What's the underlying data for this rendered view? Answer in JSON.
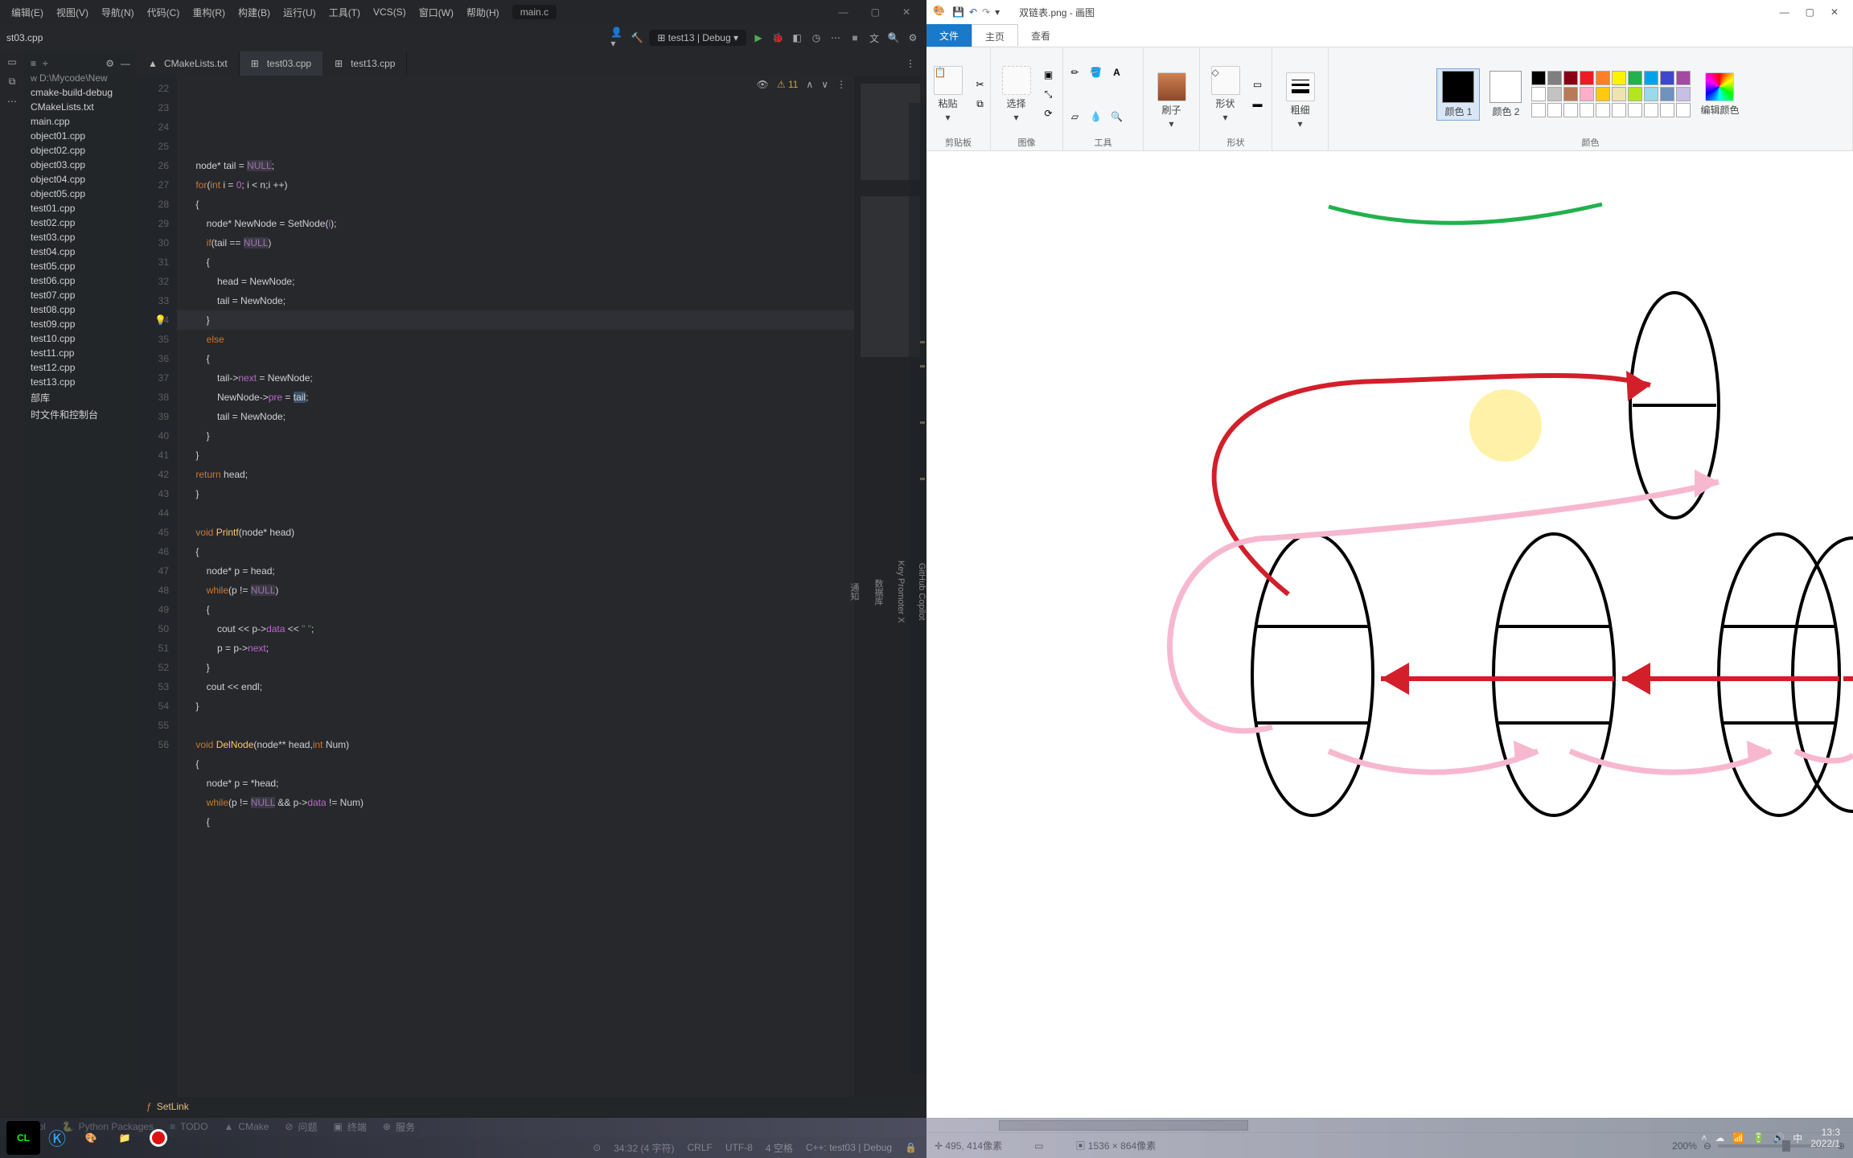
{
  "clion": {
    "title_combo": "main.c",
    "menu": [
      "编辑(E)",
      "视图(V)",
      "导航(N)",
      "代码(C)",
      "重构(R)",
      "构建(B)",
      "运行(U)",
      "工具(T)",
      "VCS(S)",
      "窗口(W)",
      "帮助(H)"
    ],
    "run_config": "test13 | Debug",
    "tabs": [
      {
        "label": "CMakeLists.txt"
      },
      {
        "label": "test03.cpp"
      },
      {
        "label": "test13.cpp"
      }
    ],
    "active_tab": 1,
    "tree_path": "D:\\Mycode\\New",
    "tree": [
      "cmake-build-debug",
      "CMakeLists.txt",
      "main.cpp",
      "object01.cpp",
      "object02.cpp",
      "object03.cpp",
      "object04.cpp",
      "object05.cpp",
      "test01.cpp",
      "test02.cpp",
      "test03.cpp",
      "test04.cpp",
      "test05.cpp",
      "test06.cpp",
      "test07.cpp",
      "test08.cpp",
      "test09.cpp",
      "test10.cpp",
      "test11.cpp",
      "test12.cpp",
      "test13.cpp",
      "部库",
      "时文件和控制台"
    ],
    "open_file_tab": "st03.cpp",
    "warn_count": "11",
    "code_lines": [
      {
        "n": 22,
        "html": "node* tail = <span class='nul'>NULL</span>;"
      },
      {
        "n": 23,
        "html": "<span class='kw'>for</span>(<span class='kw'>int</span> i = <span class='fld'>0</span>; i &lt; n;i ++)"
      },
      {
        "n": 24,
        "html": "{"
      },
      {
        "n": 25,
        "html": "    node* NewNode = SetNode(<span class='fld'>i</span>);"
      },
      {
        "n": 26,
        "html": "    <span class='kw'>if</span>(tail == <span class='nul'>NULL</span>)"
      },
      {
        "n": 27,
        "html": "    {"
      },
      {
        "n": 28,
        "html": "        head = NewNode;"
      },
      {
        "n": 29,
        "html": "        tail = NewNode;"
      },
      {
        "n": 30,
        "html": "    }"
      },
      {
        "n": 31,
        "html": "    <span class='kw'>else</span>"
      },
      {
        "n": 32,
        "html": "    {"
      },
      {
        "n": 33,
        "html": "        tail-&gt;<span class='fld'>next</span> = NewNode;"
      },
      {
        "n": 34,
        "html": "        NewNode-&gt;<span class='fld'>pre</span> = <span style='background:rgba(80,120,160,0.5);'>tail</span>;"
      },
      {
        "n": 35,
        "html": "        tail = NewNode;"
      },
      {
        "n": 36,
        "html": "    }"
      },
      {
        "n": 37,
        "html": "}"
      },
      {
        "n": 38,
        "html": "<span class='kw'>return</span> head;"
      },
      {
        "n": 39,
        "html": "}"
      },
      {
        "n": 40,
        "html": ""
      },
      {
        "n": 41,
        "html": "<span class='kw'>void</span> <span class='ty'>Printf</span>(node* head)"
      },
      {
        "n": 42,
        "html": "{"
      },
      {
        "n": 43,
        "html": "    node* p = head;"
      },
      {
        "n": 44,
        "html": "    <span class='kw'>while</span>(p != <span class='nul'>NULL</span>)"
      },
      {
        "n": 45,
        "html": "    {"
      },
      {
        "n": 46,
        "html": "        cout &lt;&lt; p-&gt;<span class='fld'>data</span> &lt;&lt; <span class='str'>\" \"</span>;"
      },
      {
        "n": 47,
        "html": "        p = p-&gt;<span class='fld'>next</span>;"
      },
      {
        "n": 48,
        "html": "    }"
      },
      {
        "n": 49,
        "html": "    cout &lt;&lt; endl;"
      },
      {
        "n": 50,
        "html": "}"
      },
      {
        "n": 51,
        "html": ""
      },
      {
        "n": 52,
        "html": "<span class='kw'>void</span> <span class='ty'>DelNode</span>(node** head,<span class='kw'>int</span> Num)"
      },
      {
        "n": 53,
        "html": "{"
      },
      {
        "n": 54,
        "html": "    node* p = *head;"
      },
      {
        "n": 55,
        "html": "    <span class='kw'>while</span>(p != <span class='nul'>NULL</span> &amp;&amp; p-&gt;<span class='fld'>data</span> != Num)"
      },
      {
        "n": 56,
        "html": "    {"
      }
    ],
    "breadcrumb": "SetLink",
    "bottom_tabs": [
      "n Control",
      "Python Packages",
      "TODO",
      "CMake",
      "问题",
      "终端",
      "服务"
    ],
    "status": {
      "pos": "34:32 (4 字符)",
      "crlf": "CRLF",
      "enc": "UTF-8",
      "indent": "4 空格",
      "ctx": "C++: test03 | Debug"
    },
    "right_rail": [
      "GitHub Copilot",
      "Key Promoter X",
      "数据库",
      "通知"
    ]
  },
  "paint": {
    "title": "双链表.png - 画图",
    "qat": [
      "save-icon",
      "undo-icon",
      "redo-icon"
    ],
    "tabs": {
      "file": "文件",
      "home": "主页",
      "view": "查看"
    },
    "groups": {
      "clipboard": "剪贴板",
      "image": "图像",
      "tools": "工具",
      "shapes": "形状",
      "thick": "粗细",
      "colors": "颜色"
    },
    "btns": {
      "paste": "粘贴",
      "select": "选择",
      "brush": "刷子",
      "shape": "形状",
      "thick": "粗细",
      "color1": "颜色 1",
      "color2": "颜色 2",
      "editcolors": "编辑颜色"
    },
    "color1_value": "#000000",
    "color2_value": "#ffffff",
    "palette_row1": [
      "#000000",
      "#7f7f7f",
      "#880015",
      "#ed1c24",
      "#ff7f27",
      "#fff200",
      "#22b14c",
      "#00a2e8",
      "#3f48cc",
      "#a349a4"
    ],
    "palette_row2": [
      "#ffffff",
      "#c3c3c3",
      "#b97a57",
      "#ffaec9",
      "#ffc90e",
      "#efe4b0",
      "#b5e61d",
      "#99d9ea",
      "#7092be",
      "#c8bfe7"
    ],
    "palette_row3": [
      "#ffffff",
      "#ffffff",
      "#ffffff",
      "#ffffff",
      "#ffffff",
      "#ffffff",
      "#ffffff",
      "#ffffff",
      "#ffffff",
      "#ffffff"
    ],
    "status": {
      "cursor": "495, 414像素",
      "size": "1536 × 864像素",
      "zoom": "200%"
    }
  },
  "taskbar": {
    "ime": "中",
    "time": "13:3",
    "date": "2022/1"
  },
  "chart_data": {
    "type": "diagram",
    "description": "Hand-drawn doubly-linked-list diagram: 3 full oval nodes in a row plus one partially visible 4th node at far right, each oval split horizontally into 3 segments; red arrows from each node to its right neighbor (next), crimson arrows from each node to its left neighbor (prev); an additional inserted node drawn above-right with red arrow inbound and pink arrow outbound; pink curved arrows along the bottom run right (next chain); a green curved stroke at the very top center; a pale yellow circular highlight between node 1 and the inserted node."
  }
}
